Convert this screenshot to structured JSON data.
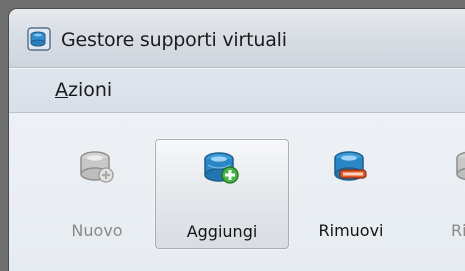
{
  "window": {
    "title": "Gestore supporti virtuali",
    "app_icon": "virtual-media-manager-icon"
  },
  "menubar": {
    "items": [
      {
        "label_mnemonic": "A",
        "label_rest": "zioni"
      }
    ]
  },
  "toolbar": {
    "buttons": [
      {
        "label": "Nuovo",
        "icon": "disk-new-icon",
        "state": "disabled"
      },
      {
        "label": "Aggiungi",
        "icon": "disk-add-icon",
        "state": "pressed"
      },
      {
        "label": "Rimuovi",
        "icon": "disk-remove-icon",
        "state": "normal"
      },
      {
        "label": "Ril",
        "icon": "disk-release-icon",
        "state": "disabled"
      }
    ]
  },
  "colors": {
    "disk_blue": "#1f86c8",
    "add_green": "#3aa53a",
    "remove_red": "#d34b1f",
    "disabled_gray": "#9a9a9a"
  }
}
